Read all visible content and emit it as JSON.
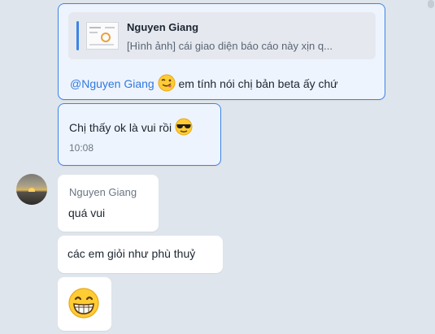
{
  "conversation": {
    "reply_message": {
      "quote": {
        "sender_name": "Nguyen Giang",
        "preview_text": "[Hình ảnh] cái giao diện báo cáo này xịn q..."
      },
      "mention": "@Nguyen Giang",
      "emoji_1": "tongue-wink-emoji",
      "text": "em tính nói chị bản beta ấy chứ"
    },
    "my_message": {
      "text": "Chị thấy ok là vui rồi",
      "emoji": "sunglasses-emoji",
      "time": "10:08"
    },
    "incoming": {
      "sender_name": "Nguyen Giang",
      "messages": [
        {
          "text": "quá vui"
        },
        {
          "text": "các em giỏi như phù thuỷ"
        },
        {
          "emoji": "grinning-emoji"
        }
      ]
    }
  },
  "colors": {
    "background": "#dfe5ec",
    "own_bubble": "#eef4fd",
    "accent": "#3d84e6",
    "mention": "#2f79df"
  }
}
